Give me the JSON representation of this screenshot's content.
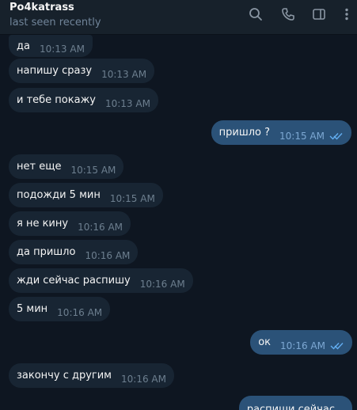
{
  "header": {
    "name": "Po4katrass",
    "status": "last seen recently",
    "icons": [
      "search-icon",
      "phone-icon",
      "sidebar-toggle-icon",
      "more-vertical-icon"
    ]
  },
  "colors": {
    "background": "#0e1621",
    "header": "#17212b",
    "incoming_bubble": "#182533",
    "outgoing_bubble": "#2b5278",
    "read_ticks": "#62adf0"
  },
  "messages": [
    {
      "dir": "in",
      "text": "да",
      "time": "10:13 AM"
    },
    {
      "dir": "in",
      "text": "напишу сразу",
      "time": "10:13 AM"
    },
    {
      "dir": "in",
      "text": "и тебе покажу",
      "time": "10:13 AM"
    },
    {
      "dir": "out",
      "text": "пришло ?",
      "time": "10:15 AM",
      "read": true
    },
    {
      "dir": "in",
      "text": "нет еще",
      "time": "10:15 AM"
    },
    {
      "dir": "in",
      "text": "подожди 5 мин",
      "time": "10:15 AM"
    },
    {
      "dir": "in",
      "text": "я не кину",
      "time": "10:16 AM"
    },
    {
      "dir": "in",
      "text": "да пришло",
      "time": "10:16 AM"
    },
    {
      "dir": "in",
      "text": "жди сейчас распишу",
      "time": "10:16 AM"
    },
    {
      "dir": "in",
      "text": "5 мин",
      "time": "10:16 AM"
    },
    {
      "dir": "out",
      "text": "ок",
      "time": "10:16 AM",
      "read": true
    },
    {
      "dir": "in",
      "text": "закончу с другим",
      "time": "10:16 AM"
    },
    {
      "dir": "out",
      "text": "распиши сейчас",
      "time": ""
    }
  ]
}
